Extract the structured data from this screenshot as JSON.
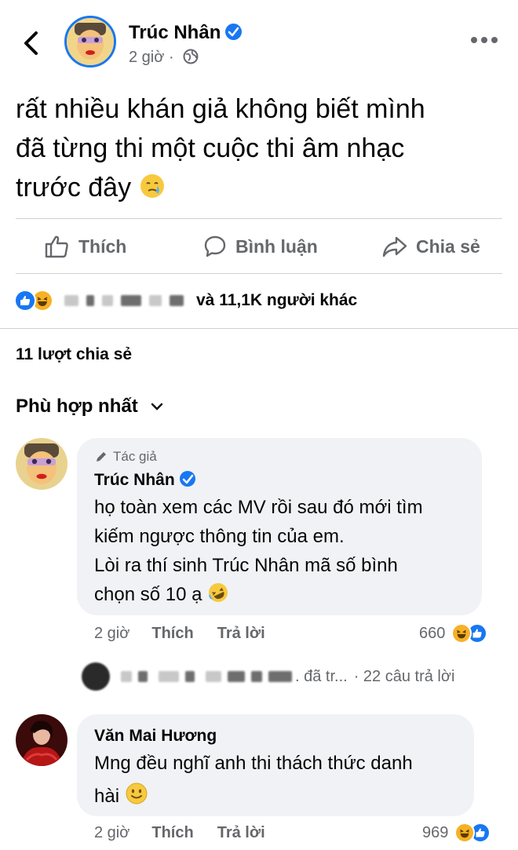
{
  "header": {
    "author_name": "Trúc Nhân",
    "time": "2 giờ",
    "icons": [
      "back-icon",
      "verified-icon",
      "globe-icon",
      "more-icon"
    ]
  },
  "post": {
    "line1": "rất nhiều khán giả không biết mình",
    "line2": "đã từng thi một cuộc thi âm nhạc",
    "line3": "trước đây",
    "emoji": "crying-smile-emoji"
  },
  "actions": {
    "like": "Thích",
    "comment": "Bình luận",
    "share": "Chia sẻ"
  },
  "reactions": {
    "summary": "và 11,1K người khác",
    "types": [
      "like",
      "haha"
    ]
  },
  "shares": {
    "label": "11 lượt chia sẻ"
  },
  "sort": {
    "label": "Phù hợp nhất"
  },
  "comments": [
    {
      "author_tag": "Tác giả",
      "name": "Trúc Nhân",
      "lines": [
        "họ toàn xem các MV rồi sau đó mới tìm",
        "kiếm ngược thông tin của em.",
        "Lòi ra thí sinh Trúc Nhân mã số bình",
        "chọn số 10 ạ"
      ],
      "time": "2 giờ",
      "like": "Thích",
      "reply": "Trả lời",
      "reaction_count": "660"
    },
    {
      "name": "Văn Mai Hương",
      "lines": [
        "Mng đều nghĩ anh thi thách thức danh",
        "hài"
      ],
      "time": "2 giờ",
      "like": "Thích",
      "reply": "Trả lời",
      "reaction_count": "969"
    }
  ],
  "replies": {
    "replied": ". đã tr...",
    "count": "· 22 câu trả lời"
  },
  "colors": {
    "accent": "#1877f2",
    "muted": "#65676b",
    "bubble": "#f0f2f5",
    "haha": "#f7b125"
  }
}
